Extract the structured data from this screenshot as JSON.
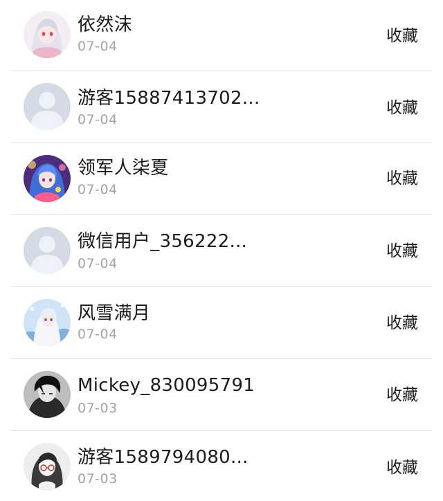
{
  "items": [
    {
      "name": "依然沫",
      "date": "07-04",
      "action": "收藏",
      "avatar": "anime-girl-silver-hair-avatar"
    },
    {
      "name": "游客15887413702...",
      "date": "07-04",
      "action": "收藏",
      "avatar": "default-user-avatar"
    },
    {
      "name": "领军人柒夏",
      "date": "07-04",
      "action": "收藏",
      "avatar": "anime-girl-blue-hair-avatar"
    },
    {
      "name": "微信用户_356222...",
      "date": "07-04",
      "action": "收藏",
      "avatar": "default-user-avatar"
    },
    {
      "name": "风雪满月",
      "date": "07-04",
      "action": "收藏",
      "avatar": "anime-girl-white-dress-avatar"
    },
    {
      "name": "Mickey_830095791",
      "date": "07-03",
      "action": "收藏",
      "avatar": "grayscale-boy-avatar"
    },
    {
      "name": "游客1589794080...",
      "date": "07-03",
      "action": "收藏",
      "avatar": "sketch-girl-glasses-avatar"
    }
  ]
}
